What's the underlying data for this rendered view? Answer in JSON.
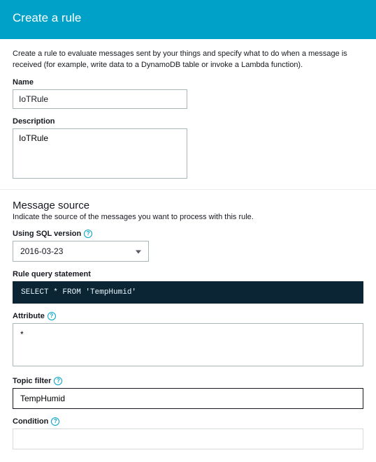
{
  "banner": {
    "title": "Create a rule"
  },
  "intro": "Create a rule to evaluate messages sent by your things and specify what to do when a message is received (for example, write data to a DynamoDB table or invoke a Lambda function).",
  "name": {
    "label": "Name",
    "value": "IoTRule"
  },
  "description": {
    "label": "Description",
    "value": "IoTRule"
  },
  "messageSource": {
    "title": "Message source",
    "subtitle": "Indicate the source of the messages you want to process with this rule.",
    "sqlVersionLabel": "Using SQL version",
    "sqlVersionValue": "2016-03-23",
    "queryLabel": "Rule query statement",
    "queryValue": "SELECT * FROM 'TempHumid'",
    "attributeLabel": "Attribute",
    "attributeValue": "*",
    "topicFilterLabel": "Topic filter",
    "topicFilterValue": "TempHumid",
    "conditionLabel": "Condition",
    "conditionValue": ""
  }
}
